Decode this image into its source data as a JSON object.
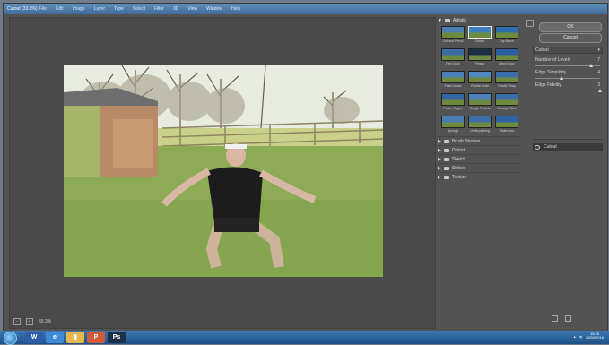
{
  "window": {
    "title": "Cutout (33.3%)",
    "menu": [
      "File",
      "Edit",
      "Image",
      "Layer",
      "Type",
      "Select",
      "Filter",
      "3D",
      "View",
      "Window",
      "Help"
    ]
  },
  "preview": {
    "zoom_minus": "-",
    "zoom_plus": "+",
    "zoom_level": "33.3%"
  },
  "gallery": {
    "category": "Artistic",
    "thumbnails": [
      {
        "label": "Colored Pencil",
        "color": "#4d7fb3"
      },
      {
        "label": "Cutout",
        "color": "#3f7fbd",
        "selected": true
      },
      {
        "label": "Dry Brush",
        "color": "#2f6fb0"
      },
      {
        "label": "Film Grain",
        "color": "#3c6ea5"
      },
      {
        "label": "Fresco",
        "color": "#1c2d44"
      },
      {
        "label": "Neon Glow",
        "color": "#2b5fa0"
      },
      {
        "label": "Paint Daubs",
        "color": "#4b7fb8"
      },
      {
        "label": "Palette Knife",
        "color": "#5588bf"
      },
      {
        "label": "Plastic Wrap",
        "color": "#3d6fae"
      },
      {
        "label": "Poster Edges",
        "color": "#3567a6"
      },
      {
        "label": "Rough Pastels",
        "color": "#4f82bb"
      },
      {
        "label": "Smudge Stick",
        "color": "#3b6daa"
      },
      {
        "label": "Sponge",
        "color": "#4a7db6"
      },
      {
        "label": "Underpainting",
        "color": "#3a6ca9"
      },
      {
        "label": "Watercolor",
        "color": "#2d63a3"
      }
    ],
    "other_categories": [
      "Brush Strokes",
      "Distort",
      "Sketch",
      "Stylize",
      "Texture"
    ]
  },
  "settings": {
    "ok_label": "OK",
    "cancel_label": "Cancel",
    "filter_name": "Cutout",
    "params": [
      {
        "label": "Number of Levels",
        "value": "7",
        "fraction": 0.86
      },
      {
        "label": "Edge Simplicity",
        "value": "4",
        "fraction": 0.4
      },
      {
        "label": "Edge Fidelity",
        "value": "3",
        "fraction": 1.0
      }
    ],
    "layer_name": "Cutout"
  },
  "taskbar": {
    "time": "15:25",
    "date": "20/04/2016",
    "apps": [
      {
        "name": "word-icon",
        "color": "#2d5ca8",
        "glyph": "W"
      },
      {
        "name": "internet-explorer-icon",
        "color": "#3e8ad4",
        "glyph": "e"
      },
      {
        "name": "explorer-icon",
        "color": "#e8b64a",
        "glyph": "▮"
      },
      {
        "name": "paint-icon",
        "color": "#d25a3a",
        "glyph": "P"
      },
      {
        "name": "photoshop-icon",
        "color": "#1a3146",
        "glyph": "Ps"
      }
    ]
  }
}
